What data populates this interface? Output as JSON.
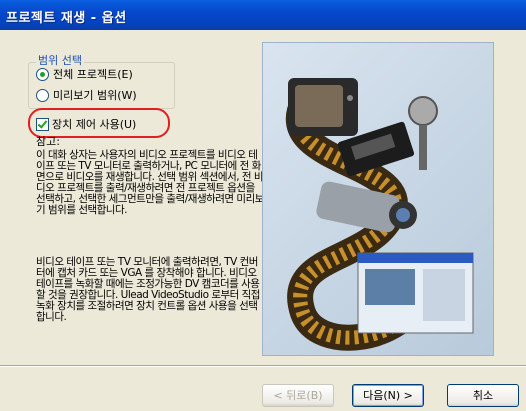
{
  "window": {
    "title": "프로젝트 재생 - 옵션"
  },
  "range": {
    "legend": "범위 선택",
    "options": [
      "전체 프로젝트(E)",
      "미리보기 범위(W)"
    ],
    "selected_index": 0
  },
  "device_control": {
    "label": "장치 제어 사용(U)",
    "checked": true
  },
  "note": {
    "label": "참고:",
    "paragraph1": "이 대화 상자는 사용자의 비디오 프로젝트를 비디오 테이프 또는 TV 모니터로 출력하거나, PC 모니터에 전 화면으로 비디오를 재생합니다. 선택 범위 섹션에서, 전 비디오 프로젝트를 출력/재생하려면 전 프로젝트 옵션을 선택하고, 선택한 세그먼트만을 출력/재생하려면 미리보기 범위를 선택합니다.",
    "paragraph2": "비디오 테이프 또는 TV 모니터에 출력하려면, TV 컨버터에 캡처 카드 또는 VGA 를 장착해야 합니다. 비디오 테이프를 녹화할 때에는 조정가능한 DV 캠코더를 사용할 것을 권장합니다. Ulead VideoStudio 로부터 직접 녹화 장치를 조절하려면 장치 컨트롤 옵션 사용을 선택합니다."
  },
  "buttons": {
    "back": "< 뒤로(B)",
    "next": "다음(N) >",
    "cancel": "취소"
  }
}
